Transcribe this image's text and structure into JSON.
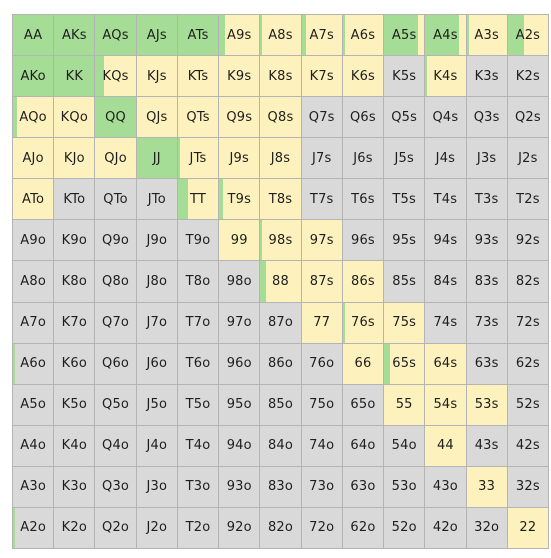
{
  "colors": {
    "raise": "#a6dd96",
    "call": "#fdf2bd",
    "fold": "#d9d9d9"
  },
  "grid": {
    "rows": [
      [
        {
          "label": "AA",
          "raise": 1,
          "call": 0
        },
        {
          "label": "AKs",
          "raise": 1,
          "call": 0
        },
        {
          "label": "AQs",
          "raise": 1,
          "call": 0
        },
        {
          "label": "AJs",
          "raise": 1,
          "call": 0
        },
        {
          "label": "ATs",
          "raise": 1,
          "call": 0
        },
        {
          "label": "A9s",
          "raise": 0.15,
          "call": 0.85
        },
        {
          "label": "A8s",
          "raise": 0.05,
          "call": 0.95
        },
        {
          "label": "A7s",
          "raise": 0.1,
          "call": 0.9
        },
        {
          "label": "A6s",
          "raise": 0.05,
          "call": 0.95
        },
        {
          "label": "A5s",
          "raise": 0.85,
          "call": 0.15
        },
        {
          "label": "A4s",
          "raise": 0.85,
          "call": 0.15
        },
        {
          "label": "A3s",
          "raise": 0.05,
          "call": 0.95
        },
        {
          "label": "A2s",
          "raise": 0.4,
          "call": 0.6
        }
      ],
      [
        {
          "label": "AKo",
          "raise": 1,
          "call": 0
        },
        {
          "label": "KK",
          "raise": 1,
          "call": 0
        },
        {
          "label": "KQs",
          "raise": 0.2,
          "call": 0.8
        },
        {
          "label": "KJs",
          "raise": 0,
          "call": 1
        },
        {
          "label": "KTs",
          "raise": 0,
          "call": 1
        },
        {
          "label": "K9s",
          "raise": 0,
          "call": 1
        },
        {
          "label": "K8s",
          "raise": 0,
          "call": 1
        },
        {
          "label": "K7s",
          "raise": 0,
          "call": 1
        },
        {
          "label": "K6s",
          "raise": 0,
          "call": 1
        },
        {
          "label": "K5s",
          "raise": 0,
          "call": 0
        },
        {
          "label": "K4s",
          "raise": 0.05,
          "call": 0.95
        },
        {
          "label": "K3s",
          "raise": 0,
          "call": 0
        },
        {
          "label": "K2s",
          "raise": 0,
          "call": 0
        }
      ],
      [
        {
          "label": "AQo",
          "raise": 0.1,
          "call": 0.9
        },
        {
          "label": "KQo",
          "raise": 0,
          "call": 1
        },
        {
          "label": "QQ",
          "raise": 1,
          "call": 0
        },
        {
          "label": "QJs",
          "raise": 0,
          "call": 1
        },
        {
          "label": "QTs",
          "raise": 0,
          "call": 1
        },
        {
          "label": "Q9s",
          "raise": 0,
          "call": 1
        },
        {
          "label": "Q8s",
          "raise": 0,
          "call": 1
        },
        {
          "label": "Q7s",
          "raise": 0,
          "call": 0
        },
        {
          "label": "Q6s",
          "raise": 0,
          "call": 0
        },
        {
          "label": "Q5s",
          "raise": 0,
          "call": 0
        },
        {
          "label": "Q4s",
          "raise": 0,
          "call": 0
        },
        {
          "label": "Q3s",
          "raise": 0,
          "call": 0
        },
        {
          "label": "Q2s",
          "raise": 0,
          "call": 0
        }
      ],
      [
        {
          "label": "AJo",
          "raise": 0,
          "call": 1
        },
        {
          "label": "KJo",
          "raise": 0,
          "call": 1
        },
        {
          "label": "QJo",
          "raise": 0,
          "call": 1
        },
        {
          "label": "JJ",
          "raise": 1,
          "call": 0
        },
        {
          "label": "JTs",
          "raise": 0.05,
          "call": 0.95
        },
        {
          "label": "J9s",
          "raise": 0,
          "call": 1
        },
        {
          "label": "J8s",
          "raise": 0,
          "call": 1
        },
        {
          "label": "J7s",
          "raise": 0,
          "call": 0
        },
        {
          "label": "J6s",
          "raise": 0,
          "call": 0
        },
        {
          "label": "J5s",
          "raise": 0,
          "call": 0
        },
        {
          "label": "J4s",
          "raise": 0,
          "call": 0
        },
        {
          "label": "J3s",
          "raise": 0,
          "call": 0
        },
        {
          "label": "J2s",
          "raise": 0,
          "call": 0
        }
      ],
      [
        {
          "label": "ATo",
          "raise": 0,
          "call": 1
        },
        {
          "label": "KTo",
          "raise": 0,
          "call": 0
        },
        {
          "label": "QTo",
          "raise": 0,
          "call": 0
        },
        {
          "label": "JTo",
          "raise": 0,
          "call": 0
        },
        {
          "label": "TT",
          "raise": 0.25,
          "call": 0.75
        },
        {
          "label": "T9s",
          "raise": 0.1,
          "call": 0.9
        },
        {
          "label": "T8s",
          "raise": 0,
          "call": 1
        },
        {
          "label": "T7s",
          "raise": 0,
          "call": 0
        },
        {
          "label": "T6s",
          "raise": 0,
          "call": 0
        },
        {
          "label": "T5s",
          "raise": 0,
          "call": 0
        },
        {
          "label": "T4s",
          "raise": 0,
          "call": 0
        },
        {
          "label": "T3s",
          "raise": 0,
          "call": 0
        },
        {
          "label": "T2s",
          "raise": 0,
          "call": 0
        }
      ],
      [
        {
          "label": "A9o",
          "raise": 0,
          "call": 0
        },
        {
          "label": "K9o",
          "raise": 0,
          "call": 0
        },
        {
          "label": "Q9o",
          "raise": 0,
          "call": 0
        },
        {
          "label": "J9o",
          "raise": 0,
          "call": 0
        },
        {
          "label": "T9o",
          "raise": 0,
          "call": 0
        },
        {
          "label": "99",
          "raise": 0,
          "call": 1
        },
        {
          "label": "98s",
          "raise": 0.05,
          "call": 0.95
        },
        {
          "label": "97s",
          "raise": 0,
          "call": 1
        },
        {
          "label": "96s",
          "raise": 0,
          "call": 0
        },
        {
          "label": "95s",
          "raise": 0,
          "call": 0
        },
        {
          "label": "94s",
          "raise": 0,
          "call": 0
        },
        {
          "label": "93s",
          "raise": 0,
          "call": 0
        },
        {
          "label": "92s",
          "raise": 0,
          "call": 0
        }
      ],
      [
        {
          "label": "A8o",
          "raise": 0,
          "call": 0
        },
        {
          "label": "K8o",
          "raise": 0,
          "call": 0
        },
        {
          "label": "Q8o",
          "raise": 0,
          "call": 0
        },
        {
          "label": "J8o",
          "raise": 0,
          "call": 0
        },
        {
          "label": "T8o",
          "raise": 0,
          "call": 0
        },
        {
          "label": "98o",
          "raise": 0,
          "call": 0
        },
        {
          "label": "88",
          "raise": 0.15,
          "call": 0.85
        },
        {
          "label": "87s",
          "raise": 0,
          "call": 1
        },
        {
          "label": "86s",
          "raise": 0,
          "call": 1
        },
        {
          "label": "85s",
          "raise": 0,
          "call": 0
        },
        {
          "label": "84s",
          "raise": 0,
          "call": 0
        },
        {
          "label": "83s",
          "raise": 0,
          "call": 0
        },
        {
          "label": "82s",
          "raise": 0,
          "call": 0
        }
      ],
      [
        {
          "label": "A7o",
          "raise": 0,
          "call": 0
        },
        {
          "label": "K7o",
          "raise": 0,
          "call": 0
        },
        {
          "label": "Q7o",
          "raise": 0,
          "call": 0
        },
        {
          "label": "J7o",
          "raise": 0,
          "call": 0
        },
        {
          "label": "T7o",
          "raise": 0,
          "call": 0
        },
        {
          "label": "97o",
          "raise": 0,
          "call": 0
        },
        {
          "label": "87o",
          "raise": 0,
          "call": 0
        },
        {
          "label": "77",
          "raise": 0,
          "call": 1
        },
        {
          "label": "76s",
          "raise": 0.05,
          "call": 0.95
        },
        {
          "label": "75s",
          "raise": 0,
          "call": 1
        },
        {
          "label": "74s",
          "raise": 0,
          "call": 0
        },
        {
          "label": "73s",
          "raise": 0,
          "call": 0
        },
        {
          "label": "72s",
          "raise": 0,
          "call": 0
        }
      ],
      [
        {
          "label": "A6o",
          "raise": 0.05,
          "call": 0
        },
        {
          "label": "K6o",
          "raise": 0,
          "call": 0
        },
        {
          "label": "Q6o",
          "raise": 0,
          "call": 0
        },
        {
          "label": "J6o",
          "raise": 0,
          "call": 0
        },
        {
          "label": "T6o",
          "raise": 0,
          "call": 0
        },
        {
          "label": "96o",
          "raise": 0,
          "call": 0
        },
        {
          "label": "86o",
          "raise": 0,
          "call": 0
        },
        {
          "label": "76o",
          "raise": 0,
          "call": 0
        },
        {
          "label": "66",
          "raise": 0,
          "call": 1
        },
        {
          "label": "65s",
          "raise": 0.15,
          "call": 0.85
        },
        {
          "label": "64s",
          "raise": 0,
          "call": 1
        },
        {
          "label": "63s",
          "raise": 0,
          "call": 0
        },
        {
          "label": "62s",
          "raise": 0,
          "call": 0
        }
      ],
      [
        {
          "label": "A5o",
          "raise": 0,
          "call": 0
        },
        {
          "label": "K5o",
          "raise": 0,
          "call": 0
        },
        {
          "label": "Q5o",
          "raise": 0,
          "call": 0
        },
        {
          "label": "J5o",
          "raise": 0,
          "call": 0
        },
        {
          "label": "T5o",
          "raise": 0,
          "call": 0
        },
        {
          "label": "95o",
          "raise": 0,
          "call": 0
        },
        {
          "label": "85o",
          "raise": 0,
          "call": 0
        },
        {
          "label": "75o",
          "raise": 0,
          "call": 0
        },
        {
          "label": "65o",
          "raise": 0,
          "call": 0
        },
        {
          "label": "55",
          "raise": 0,
          "call": 1
        },
        {
          "label": "54s",
          "raise": 0,
          "call": 1
        },
        {
          "label": "53s",
          "raise": 0,
          "call": 1
        },
        {
          "label": "52s",
          "raise": 0,
          "call": 0
        }
      ],
      [
        {
          "label": "A4o",
          "raise": 0,
          "call": 0
        },
        {
          "label": "K4o",
          "raise": 0,
          "call": 0
        },
        {
          "label": "Q4o",
          "raise": 0,
          "call": 0
        },
        {
          "label": "J4o",
          "raise": 0,
          "call": 0
        },
        {
          "label": "T4o",
          "raise": 0,
          "call": 0
        },
        {
          "label": "94o",
          "raise": 0,
          "call": 0
        },
        {
          "label": "84o",
          "raise": 0,
          "call": 0
        },
        {
          "label": "74o",
          "raise": 0,
          "call": 0
        },
        {
          "label": "64o",
          "raise": 0,
          "call": 0
        },
        {
          "label": "54o",
          "raise": 0,
          "call": 0
        },
        {
          "label": "44",
          "raise": 0,
          "call": 1
        },
        {
          "label": "43s",
          "raise": 0,
          "call": 0
        },
        {
          "label": "42s",
          "raise": 0,
          "call": 0
        }
      ],
      [
        {
          "label": "A3o",
          "raise": 0,
          "call": 0
        },
        {
          "label": "K3o",
          "raise": 0,
          "call": 0
        },
        {
          "label": "Q3o",
          "raise": 0,
          "call": 0
        },
        {
          "label": "J3o",
          "raise": 0,
          "call": 0
        },
        {
          "label": "T3o",
          "raise": 0,
          "call": 0
        },
        {
          "label": "93o",
          "raise": 0,
          "call": 0
        },
        {
          "label": "83o",
          "raise": 0,
          "call": 0
        },
        {
          "label": "73o",
          "raise": 0,
          "call": 0
        },
        {
          "label": "63o",
          "raise": 0,
          "call": 0
        },
        {
          "label": "53o",
          "raise": 0,
          "call": 0
        },
        {
          "label": "43o",
          "raise": 0,
          "call": 0
        },
        {
          "label": "33",
          "raise": 0,
          "call": 1
        },
        {
          "label": "32s",
          "raise": 0,
          "call": 0
        }
      ],
      [
        {
          "label": "A2o",
          "raise": 0.05,
          "call": 0
        },
        {
          "label": "K2o",
          "raise": 0,
          "call": 0
        },
        {
          "label": "Q2o",
          "raise": 0,
          "call": 0
        },
        {
          "label": "J2o",
          "raise": 0,
          "call": 0
        },
        {
          "label": "T2o",
          "raise": 0,
          "call": 0
        },
        {
          "label": "92o",
          "raise": 0,
          "call": 0
        },
        {
          "label": "82o",
          "raise": 0,
          "call": 0
        },
        {
          "label": "72o",
          "raise": 0,
          "call": 0
        },
        {
          "label": "62o",
          "raise": 0,
          "call": 0
        },
        {
          "label": "52o",
          "raise": 0,
          "call": 0
        },
        {
          "label": "42o",
          "raise": 0,
          "call": 0
        },
        {
          "label": "32o",
          "raise": 0,
          "call": 0
        },
        {
          "label": "22",
          "raise": 0,
          "call": 1
        }
      ]
    ]
  }
}
